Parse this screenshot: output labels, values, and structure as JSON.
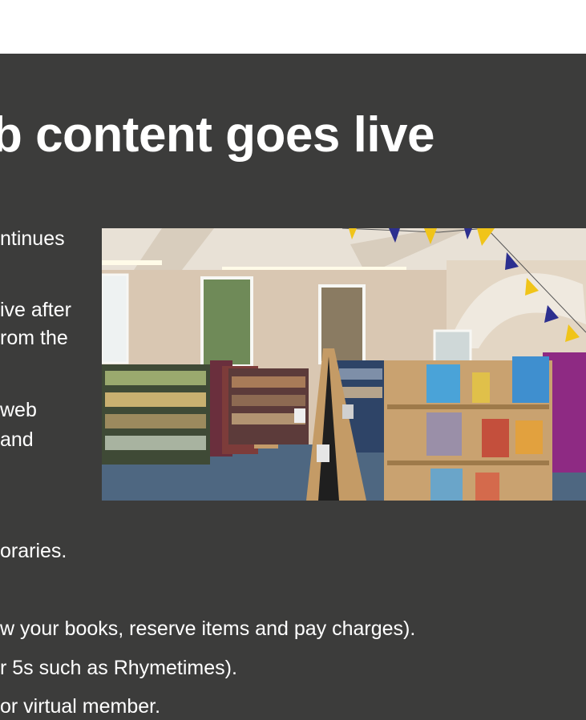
{
  "slide": {
    "title": "eb content goes live",
    "left_column_lines": [
      "ntinues",
      "ive after",
      "rom the",
      "web",
      "and"
    ],
    "lower_lines": [
      "oraries.",
      "w your books, reserve items and pay charges).",
      "r 5s such as Rhymetimes).",
      " or virtual member."
    ]
  },
  "photo": {
    "subject": "library-interior-photo",
    "colors": {
      "ceiling": "#e8e1d6",
      "wall": "#d9c7b2",
      "carpet": "#4e6781",
      "shelf_wood": "#c9a270",
      "magenta_wall": "#8e2a83",
      "bunting_yellow": "#f0c419",
      "bunting_blue": "#2c2f8f"
    }
  }
}
